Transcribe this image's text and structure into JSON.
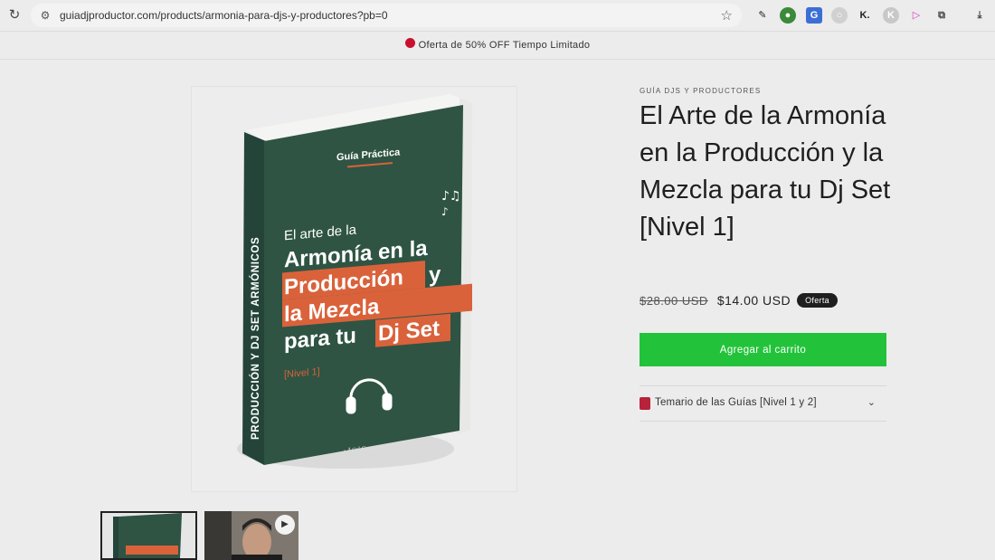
{
  "browser": {
    "url": "guiadjproductor.com/products/armonia-para-djs-y-productores?pb=0",
    "extensions": [
      "K."
    ]
  },
  "announcement": {
    "text": "Oferta de 50% OFF Tiempo Limitado"
  },
  "product": {
    "vendor": "GUÍA DJS Y PRODUCTORES",
    "title": "El Arte de la Armonía en la Producción y la Mezcla para tu Dj Set [Nivel 1]",
    "price_old": "$28.00 USD",
    "price_new": "$14.00 USD",
    "badge": "Oferta",
    "add_to_cart": "Agregar al carrito",
    "accordion_label": "Temario de las Guías [Nivel 1 y 2]"
  },
  "book_cover": {
    "spine": "PRODUCCIÓN Y DJ SET ARMÓNICOS",
    "kicker": "Guía Práctica",
    "line1": "El arte de la",
    "line2": "Armonía en la",
    "line3a": "Producción",
    "line3b": "y",
    "line4": "la Mezcla",
    "line5a": "para tu",
    "line5b": "Dj Set",
    "level": "[Nivel 1]",
    "author": "- Ariel Contreras -"
  },
  "colors": {
    "accent_green": "#22c33a",
    "cover_green": "#2f5443",
    "cover_orange": "#d9623b"
  }
}
